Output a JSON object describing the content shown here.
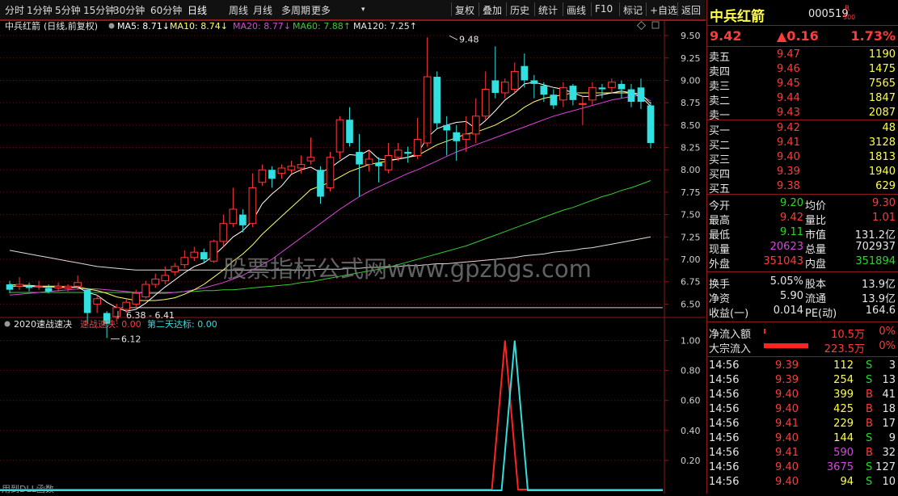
{
  "toolbar": {
    "left_items": [
      "分时",
      "1分钟",
      "5分钟",
      "15分钟",
      "30分钟",
      "60分钟",
      "日线",
      "周线",
      "月线",
      "多周期",
      "更多"
    ],
    "right_items": [
      "复权",
      "叠加",
      "历史",
      "统计",
      "画线",
      "F10",
      "标记",
      "+自选",
      "返回"
    ],
    "active": "日线",
    "more_arrow": "▾"
  },
  "legend": {
    "stock": "中兵红箭",
    "mode": "(日线,前复权)",
    "ma5": "MA5: 8.71↓",
    "ma10": "MA10: 8.74↓",
    "ma20": "MA20: 8.77↓",
    "ma60": "MA60: 7.88↑",
    "ma120": "MA120: 7.25↑"
  },
  "indicator_legend": {
    "name": "2020速战速决",
    "s1": "速战速决: 0.00",
    "s2": "第二天达标: 0.00",
    "footer": "用到DLL函数"
  },
  "watermark": "股票指标公式网www.gpzbgs.com",
  "price_labels": {
    "high": "9.48",
    "low": "6.12",
    "range": "6.38 - 6.41"
  },
  "colors": {
    "up": "#ff3b3b",
    "down": "#33e0e0",
    "ma5": "#ffffff",
    "ma10": "#ffff66",
    "ma20": "#dd44dd",
    "ma60": "#33cc33",
    "ma120": "#dddddd",
    "grid": "#5a1010"
  },
  "chart_data": {
    "type": "candlestick",
    "ylim": [
      6.35,
      9.6
    ],
    "yticks": [
      "9.50",
      "9.25",
      "9.00",
      "8.75",
      "8.50",
      "8.25",
      "8.00",
      "7.75",
      "7.50",
      "7.25",
      "7.00",
      "6.75",
      "6.50"
    ],
    "candles": [
      [
        6.72,
        6.66,
        6.76,
        6.62
      ],
      [
        6.7,
        6.72,
        6.8,
        6.66
      ],
      [
        6.7,
        6.68,
        6.74,
        6.64
      ],
      [
        6.7,
        6.7,
        6.76,
        6.66
      ],
      [
        6.68,
        6.64,
        6.72,
        6.62
      ],
      [
        6.68,
        6.7,
        6.74,
        6.64
      ],
      [
        6.68,
        6.7,
        6.72,
        6.64
      ],
      [
        6.7,
        6.74,
        6.82,
        6.66
      ],
      [
        6.66,
        6.4,
        6.68,
        6.28
      ],
      [
        6.5,
        6.56,
        6.6,
        6.4
      ],
      [
        6.4,
        6.28,
        6.42,
        6.12
      ],
      [
        6.36,
        6.46,
        6.5,
        6.3
      ],
      [
        6.44,
        6.52,
        6.56,
        6.4
      ],
      [
        6.5,
        6.62,
        6.66,
        6.46
      ],
      [
        6.58,
        6.72,
        6.76,
        6.56
      ],
      [
        6.72,
        6.78,
        6.84,
        6.68
      ],
      [
        6.76,
        6.82,
        6.92,
        6.72
      ],
      [
        6.86,
        6.92,
        6.96,
        6.82
      ],
      [
        6.94,
        7.02,
        7.1,
        6.9
      ],
      [
        7.02,
        7.08,
        7.14,
        6.98
      ],
      [
        7.08,
        7.0,
        7.12,
        6.96
      ],
      [
        6.98,
        7.2,
        7.22,
        6.96
      ],
      [
        7.2,
        7.4,
        7.5,
        7.14
      ],
      [
        7.4,
        7.56,
        7.8,
        7.36
      ],
      [
        7.5,
        7.38,
        7.56,
        7.3
      ],
      [
        7.4,
        7.8,
        7.96,
        7.36
      ],
      [
        7.86,
        8.0,
        8.06,
        7.82
      ],
      [
        8.0,
        7.9,
        8.04,
        7.8
      ],
      [
        7.96,
        8.02,
        8.06,
        7.9
      ],
      [
        8.0,
        8.04,
        8.1,
        7.96
      ],
      [
        8.02,
        8.06,
        8.16,
        7.96
      ],
      [
        8.1,
        8.14,
        8.36,
        8.06
      ],
      [
        8.0,
        7.7,
        8.04,
        7.62
      ],
      [
        7.8,
        8.14,
        8.2,
        7.76
      ],
      [
        8.2,
        8.56,
        8.6,
        8.12
      ],
      [
        8.56,
        8.3,
        8.7,
        8.26
      ],
      [
        8.2,
        8.06,
        8.4,
        7.7
      ],
      [
        8.06,
        8.12,
        8.22,
        7.98
      ],
      [
        8.08,
        8.04,
        8.14,
        7.86
      ],
      [
        8.0,
        8.16,
        8.3,
        7.96
      ],
      [
        8.14,
        8.22,
        8.3,
        8.1
      ],
      [
        8.2,
        8.18,
        8.26,
        8.08
      ],
      [
        8.16,
        8.34,
        8.58,
        8.12
      ],
      [
        8.3,
        9.04,
        9.48,
        8.26
      ],
      [
        9.04,
        8.52,
        9.1,
        8.46
      ],
      [
        8.5,
        8.44,
        8.6,
        8.16
      ],
      [
        8.42,
        8.32,
        8.5,
        8.1
      ],
      [
        8.34,
        8.4,
        8.6,
        8.2
      ],
      [
        8.4,
        8.6,
        8.8,
        8.3
      ],
      [
        8.6,
        8.9,
        9.1,
        8.56
      ],
      [
        9.0,
        8.86,
        9.38,
        8.8
      ],
      [
        8.86,
        8.98,
        9.02,
        8.8
      ],
      [
        8.9,
        9.1,
        9.2,
        8.86
      ],
      [
        9.16,
        9.0,
        9.3,
        8.92
      ],
      [
        9.0,
        8.96,
        9.06,
        8.8
      ],
      [
        8.94,
        8.84,
        8.98,
        8.76
      ],
      [
        8.84,
        8.72,
        8.9,
        8.68
      ],
      [
        8.78,
        8.92,
        8.98,
        8.7
      ],
      [
        8.94,
        8.78,
        8.96,
        8.72
      ],
      [
        8.74,
        8.74,
        8.82,
        8.5
      ],
      [
        8.78,
        8.92,
        8.98,
        8.72
      ],
      [
        8.92,
        8.9,
        8.96,
        8.8
      ],
      [
        8.92,
        8.98,
        9.02,
        8.86
      ],
      [
        8.96,
        8.9,
        9.0,
        8.8
      ],
      [
        8.9,
        8.76,
        8.96,
        8.7
      ],
      [
        8.92,
        8.76,
        9.02,
        8.68
      ],
      [
        8.72,
        8.3,
        8.76,
        8.24
      ]
    ],
    "ma5": [
      6.7,
      6.7,
      6.7,
      6.69,
      6.69,
      6.69,
      6.68,
      6.69,
      6.63,
      6.6,
      6.52,
      6.46,
      6.42,
      6.44,
      6.51,
      6.6,
      6.69,
      6.77,
      6.85,
      6.92,
      6.96,
      7.04,
      7.14,
      7.25,
      7.32,
      7.43,
      7.62,
      7.73,
      7.82,
      7.95,
      8.0,
      8.03,
      7.97,
      8.02,
      8.1,
      8.17,
      8.16,
      8.22,
      8.12,
      8.11,
      8.12,
      8.14,
      8.18,
      8.36,
      8.46,
      8.5,
      8.53,
      8.54,
      8.46,
      8.55,
      8.66,
      8.78,
      8.86,
      8.96,
      8.98,
      8.95,
      8.92,
      8.9,
      8.86,
      8.82,
      8.82,
      8.84,
      8.86,
      8.88,
      8.86,
      8.82,
      8.71
    ],
    "ma10": [
      6.72,
      6.71,
      6.71,
      6.7,
      6.7,
      6.7,
      6.69,
      6.69,
      6.67,
      6.65,
      6.62,
      6.58,
      6.56,
      6.54,
      6.54,
      6.54,
      6.55,
      6.57,
      6.61,
      6.66,
      6.72,
      6.8,
      6.88,
      6.98,
      7.06,
      7.16,
      7.28,
      7.38,
      7.48,
      7.58,
      7.68,
      7.78,
      7.82,
      7.86,
      7.92,
      7.98,
      8.02,
      8.06,
      8.08,
      8.1,
      8.12,
      8.14,
      8.16,
      8.22,
      8.28,
      8.32,
      8.36,
      8.4,
      8.42,
      8.46,
      8.5,
      8.56,
      8.62,
      8.7,
      8.76,
      8.8,
      8.82,
      8.84,
      8.86,
      8.86,
      8.86,
      8.86,
      8.86,
      8.86,
      8.86,
      8.85,
      8.74
    ],
    "ma20": [
      6.6,
      6.61,
      6.62,
      6.63,
      6.64,
      6.65,
      6.66,
      6.67,
      6.67,
      6.67,
      6.66,
      6.65,
      6.64,
      6.63,
      6.62,
      6.62,
      6.62,
      6.63,
      6.64,
      6.66,
      6.68,
      6.71,
      6.74,
      6.78,
      6.82,
      6.88,
      6.94,
      7.0,
      7.08,
      7.16,
      7.24,
      7.32,
      7.4,
      7.48,
      7.56,
      7.63,
      7.7,
      7.76,
      7.81,
      7.86,
      7.91,
      7.96,
      8.0,
      8.05,
      8.1,
      8.15,
      8.2,
      8.24,
      8.28,
      8.32,
      8.36,
      8.4,
      8.44,
      8.48,
      8.52,
      8.56,
      8.6,
      8.63,
      8.66,
      8.69,
      8.72,
      8.75,
      8.78,
      8.8,
      8.82,
      8.83,
      8.77
    ],
    "ma60": [
      6.63,
      6.63,
      6.63,
      6.63,
      6.63,
      6.63,
      6.63,
      6.63,
      6.63,
      6.63,
      6.63,
      6.63,
      6.63,
      6.63,
      6.63,
      6.63,
      6.63,
      6.63,
      6.64,
      6.64,
      6.65,
      6.65,
      6.66,
      6.66,
      6.67,
      6.68,
      6.69,
      6.7,
      6.71,
      6.72,
      6.74,
      6.75,
      6.77,
      6.79,
      6.81,
      6.83,
      6.85,
      6.87,
      6.89,
      6.91,
      6.94,
      6.97,
      7.0,
      7.03,
      7.06,
      7.09,
      7.12,
      7.15,
      7.19,
      7.23,
      7.27,
      7.31,
      7.35,
      7.39,
      7.43,
      7.47,
      7.51,
      7.55,
      7.58,
      7.62,
      7.66,
      7.7,
      7.73,
      7.77,
      7.8,
      7.84,
      7.88
    ],
    "ma120": [
      7.1,
      7.08,
      7.06,
      7.04,
      7.02,
      7.0,
      6.98,
      6.96,
      6.94,
      6.92,
      6.91,
      6.9,
      6.89,
      6.88,
      6.88,
      6.88,
      6.88,
      6.88,
      6.88,
      6.88,
      6.88,
      6.88,
      6.88,
      6.88,
      6.88,
      6.88,
      6.88,
      6.88,
      6.88,
      6.88,
      6.88,
      6.88,
      6.89,
      6.89,
      6.89,
      6.9,
      6.9,
      6.91,
      6.91,
      6.92,
      6.92,
      6.93,
      6.93,
      6.94,
      6.95,
      6.95,
      6.96,
      6.97,
      6.98,
      6.99,
      7.0,
      7.01,
      7.02,
      7.04,
      7.05,
      7.06,
      7.08,
      7.09,
      7.1,
      7.12,
      7.13,
      7.15,
      7.17,
      7.19,
      7.21,
      7.23,
      7.25
    ],
    "indicator": {
      "ylim": [
        0,
        1.1
      ],
      "yticks": [
        "1.00",
        "0.80",
        "0.60",
        "0.40",
        "0.20"
      ],
      "signal1_index": 51,
      "signal2_index": 52
    }
  },
  "panel": {
    "name": "中兵红箭",
    "code": "000519",
    "badge_top": "R",
    "badge_bottom": "500",
    "price": "9.42",
    "change": "▲0.16",
    "pct": "1.73%",
    "asks": [
      {
        "label": "卖五",
        "price": "9.47",
        "vol": "1190"
      },
      {
        "label": "卖四",
        "price": "9.46",
        "vol": "1475"
      },
      {
        "label": "卖三",
        "price": "9.45",
        "vol": "7565"
      },
      {
        "label": "卖二",
        "price": "9.44",
        "vol": "1847"
      },
      {
        "label": "卖一",
        "price": "9.43",
        "vol": "2087"
      }
    ],
    "bids": [
      {
        "label": "买一",
        "price": "9.42",
        "vol": "48"
      },
      {
        "label": "买二",
        "price": "9.41",
        "vol": "3128"
      },
      {
        "label": "买三",
        "price": "9.40",
        "vol": "1813"
      },
      {
        "label": "买四",
        "price": "9.39",
        "vol": "1940"
      },
      {
        "label": "买五",
        "price": "9.38",
        "vol": "629"
      }
    ],
    "stats1": [
      {
        "l1": "今开",
        "v1": "9.20",
        "c1": "green",
        "l2": "均价",
        "v2": "9.30",
        "c2": "red"
      },
      {
        "l1": "最高",
        "v1": "9.42",
        "c1": "red",
        "l2": "量比",
        "v2": "1.01",
        "c2": "red"
      },
      {
        "l1": "最低",
        "v1": "9.11",
        "c1": "green",
        "l2": "市值",
        "v2": "131.2亿",
        "c2": "white"
      },
      {
        "l1": "现量",
        "v1": "20623",
        "c1": "magenta",
        "l2": "总量",
        "v2": "702937",
        "c2": "white"
      },
      {
        "l1": "外盘",
        "v1": "351043",
        "c1": "red",
        "l2": "内盘",
        "v2": "351894",
        "c2": "green"
      }
    ],
    "stats2": [
      {
        "l1": "换手",
        "v1": "5.05%",
        "l2": "股本",
        "v2": "13.9亿"
      },
      {
        "l1": "净资",
        "v1": "5.90",
        "l2": "流通",
        "v2": "13.9亿"
      },
      {
        "l1": "收益(一)",
        "v1": "0.014",
        "l2": "PE(动)",
        "v2": "164.6"
      }
    ],
    "flow": [
      {
        "label": "净流入额",
        "value": "10.5万",
        "pct": "0%",
        "bar": 0.02
      },
      {
        "label": "大宗流入",
        "value": "223.5万",
        "pct": "0%",
        "bar": 0.55
      }
    ],
    "ticks": [
      {
        "t": "14:56",
        "p": "9.39",
        "pc": "red",
        "v": "112",
        "vc": "yellow",
        "s": "S",
        "n": "3"
      },
      {
        "t": "14:56",
        "p": "9.39",
        "pc": "red",
        "v": "254",
        "vc": "yellow",
        "s": "S",
        "n": "13"
      },
      {
        "t": "14:56",
        "p": "9.40",
        "pc": "red",
        "v": "399",
        "vc": "yellow",
        "s": "B",
        "n": "41"
      },
      {
        "t": "14:56",
        "p": "9.40",
        "pc": "red",
        "v": "425",
        "vc": "yellow",
        "s": "B",
        "n": "18"
      },
      {
        "t": "14:56",
        "p": "9.41",
        "pc": "red",
        "v": "229",
        "vc": "yellow",
        "s": "B",
        "n": "17"
      },
      {
        "t": "14:56",
        "p": "9.40",
        "pc": "red",
        "v": "144",
        "vc": "yellow",
        "s": "S",
        "n": "9"
      },
      {
        "t": "14:56",
        "p": "9.41",
        "pc": "red",
        "v": "590",
        "vc": "magenta",
        "s": "B",
        "n": "32"
      },
      {
        "t": "14:56",
        "p": "9.40",
        "pc": "red",
        "v": "3675",
        "vc": "magenta",
        "s": "S",
        "n": "127"
      },
      {
        "t": "14:56",
        "p": "9.40",
        "pc": "red",
        "v": "94",
        "vc": "yellow",
        "s": "S",
        "n": "10"
      }
    ]
  }
}
